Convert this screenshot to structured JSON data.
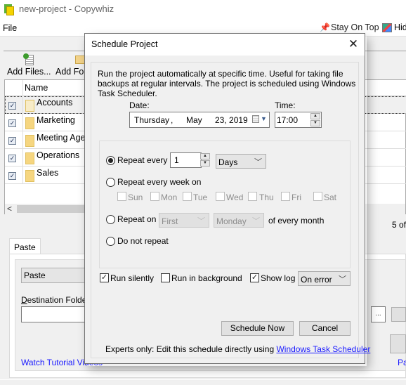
{
  "window": {
    "title": "new-project - Copywhiz",
    "menu": [
      "File"
    ],
    "stay_on_top_label": "Stay On Top",
    "hide_label": "Hide"
  },
  "toolbar": {
    "add_files_label": "Add Files...",
    "add_folder_label": "Add Folder"
  },
  "file_list": {
    "column_name": "Name",
    "rows": [
      {
        "name": "Accounts",
        "checked": true,
        "selected": true
      },
      {
        "name": "Marketing",
        "checked": true,
        "selected": false
      },
      {
        "name": "Meeting Agenda",
        "checked": true,
        "selected": false
      },
      {
        "name": "Operations",
        "checked": true,
        "selected": false
      },
      {
        "name": "Sales",
        "checked": true,
        "selected": false
      }
    ],
    "count_label": "5 of"
  },
  "bottom_panel": {
    "tab_label": "Paste",
    "paste_combo_value": "Paste",
    "destination_label": "Destination Folders",
    "destination_value": "",
    "browse_label": "...",
    "tutorial_link": "Watch Tutorial Videos",
    "right_link": "Pa"
  },
  "dialog": {
    "title": "Schedule Project",
    "description": "Run the project automatically at specific time. Useful for taking file backups at regular intervals. The project is scheduled using Windows Task Scheduler.",
    "date_label": "Date:",
    "date": {
      "weekday": "Thursday",
      "sep": ",",
      "month": "May",
      "day_year": "23, 2019"
    },
    "time_label": "Time:",
    "time_value": "17:00",
    "repeat_every_label": "Repeat every",
    "repeat_every_value": "1",
    "repeat_unit": "Days",
    "repeat_week_label": "Repeat every week on",
    "weekdays": [
      {
        "label": "Sun",
        "checked": false
      },
      {
        "label": "Mon",
        "checked": false
      },
      {
        "label": "Tue",
        "checked": false
      },
      {
        "label": "Wed",
        "checked": false
      },
      {
        "label": "Thu",
        "checked": false
      },
      {
        "label": "Fri",
        "checked": false
      },
      {
        "label": "Sat",
        "checked": false
      }
    ],
    "repeat_on_label": "Repeat on",
    "repeat_on_ordinal": "First",
    "repeat_on_day": "Monday",
    "of_every_month_label": "of every month",
    "do_not_repeat_label": "Do not repeat",
    "selected_mode": "repeat_every",
    "run_silently_label": "Run silently",
    "run_silently": true,
    "run_background_label": "Run in background",
    "run_background": false,
    "show_log_label": "Show log",
    "show_log": true,
    "show_log_option": "On error",
    "schedule_now_label": "Schedule Now",
    "cancel_label": "Cancel",
    "experts_text": "Experts only: Edit this schedule directly using",
    "task_scheduler_link": "Windows Task Scheduler",
    "close_icon": "close-icon"
  }
}
